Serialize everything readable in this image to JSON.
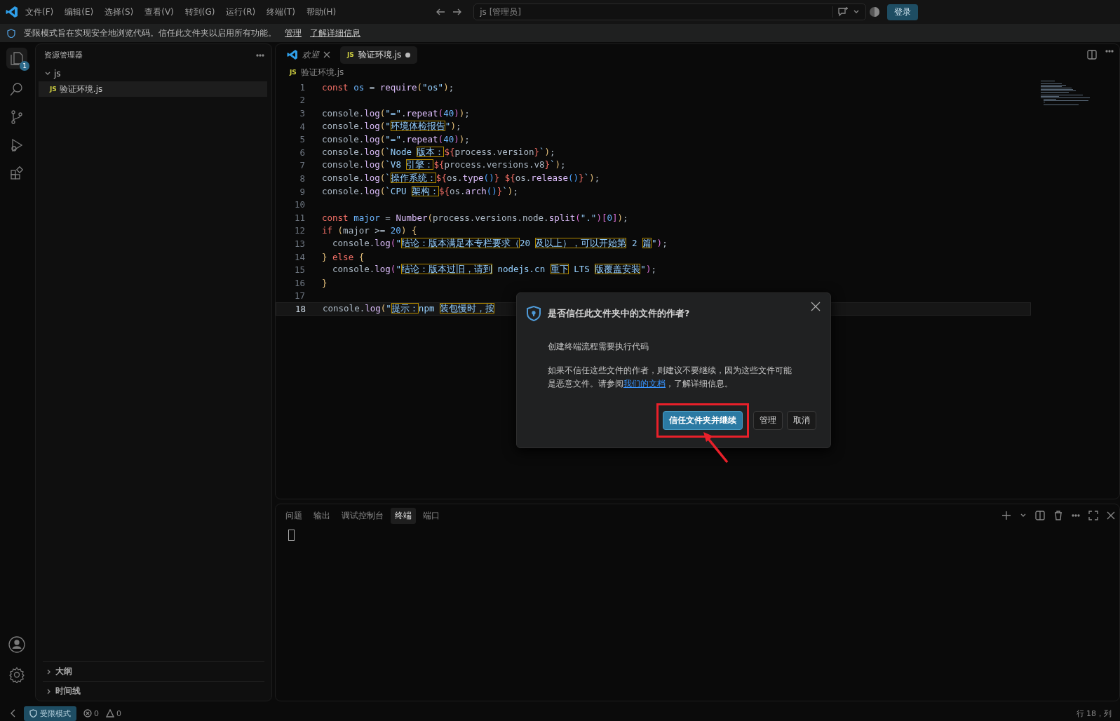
{
  "title_bar": {
    "menus": [
      "文件(F)",
      "编辑(E)",
      "选择(S)",
      "查看(V)",
      "转到(G)",
      "运行(R)",
      "终端(T)",
      "帮助(H)"
    ],
    "search": {
      "value": "js [管理员]"
    },
    "sign_in": "登录"
  },
  "banner": {
    "message": "受限模式旨在实现安全地浏览代码。信任此文件夹以启用所有功能。",
    "links": [
      "管理",
      "了解详细信息"
    ]
  },
  "activity_bar": {
    "badge": "1"
  },
  "sidebar": {
    "title": "资源管理器",
    "tree": [
      {
        "label": "js",
        "expanded": true,
        "children": [
          {
            "label": "验证环境.js",
            "badge": "JS",
            "selected": true
          }
        ]
      }
    ],
    "sections": [
      {
        "label": "大纲",
        "expanded": false
      },
      {
        "label": "时间线",
        "expanded": false
      }
    ]
  },
  "editor": {
    "tabs": [
      {
        "label": "欢迎",
        "kind": "welcome",
        "selected": false,
        "modified": false
      },
      {
        "label": "验证环境.js",
        "kind": "js",
        "badge": "JS",
        "selected": true,
        "modified": true
      }
    ],
    "breadcrumb": {
      "badge": "JS",
      "label": "验证环境.js"
    },
    "lines": [
      {
        "n": "1",
        "selected": false,
        "tokens": [
          {
            "kind": "keyword",
            "text": "const "
          },
          {
            "kind": "variable",
            "text": "os"
          },
          {
            "kind": "plain",
            "text": " = "
          },
          {
            "kind": "function",
            "text": "require"
          },
          {
            "kind": "bracket1",
            "text": "("
          },
          {
            "kind": "string",
            "text": "\"os\""
          },
          {
            "kind": "bracket1",
            "text": ")"
          },
          {
            "kind": "plain",
            "text": ";"
          }
        ]
      },
      {
        "n": "2",
        "selected": false
      },
      {
        "n": "3",
        "selected": false,
        "tokens": [
          {
            "kind": "plain",
            "text": "console."
          },
          {
            "kind": "function",
            "text": "log"
          },
          {
            "kind": "bracket1",
            "text": "("
          },
          {
            "kind": "string",
            "text": "\"=\""
          },
          {
            "kind": "plain",
            "text": "."
          },
          {
            "kind": "function",
            "text": "repeat"
          },
          {
            "kind": "bracket2",
            "text": "("
          },
          {
            "kind": "number",
            "text": "40"
          },
          {
            "kind": "bracket2",
            "text": ")"
          },
          {
            "kind": "bracket1",
            "text": ")"
          },
          {
            "kind": "plain",
            "text": ";"
          }
        ]
      },
      {
        "n": "4",
        "selected": false,
        "tokens": [
          {
            "kind": "plain",
            "text": "console."
          },
          {
            "kind": "function",
            "text": "log"
          },
          {
            "kind": "bracket1",
            "text": "("
          },
          {
            "kind": "string",
            "text": "\""
          },
          {
            "kind": "unicode",
            "text": "环境体检报告"
          },
          {
            "kind": "string",
            "text": "\""
          },
          {
            "kind": "bracket1",
            "text": ")"
          },
          {
            "kind": "plain",
            "text": ";"
          }
        ]
      },
      {
        "n": "5",
        "selected": false,
        "tokens": [
          {
            "kind": "plain",
            "text": "console."
          },
          {
            "kind": "function",
            "text": "log"
          },
          {
            "kind": "bracket1",
            "text": "("
          },
          {
            "kind": "string",
            "text": "\"=\""
          },
          {
            "kind": "plain",
            "text": "."
          },
          {
            "kind": "function",
            "text": "repeat"
          },
          {
            "kind": "bracket2",
            "text": "("
          },
          {
            "kind": "number",
            "text": "40"
          },
          {
            "kind": "bracket2",
            "text": ")"
          },
          {
            "kind": "bracket1",
            "text": ")"
          },
          {
            "kind": "plain",
            "text": ";"
          }
        ]
      },
      {
        "n": "6",
        "selected": false,
        "tokens": [
          {
            "kind": "plain",
            "text": "console."
          },
          {
            "kind": "function",
            "text": "log"
          },
          {
            "kind": "bracket1",
            "text": "("
          },
          {
            "kind": "string",
            "text": "`Node "
          },
          {
            "kind": "unicode",
            "text": "版本："
          },
          {
            "kind": "interp",
            "text": "${"
          },
          {
            "kind": "plain",
            "text": "process.version"
          },
          {
            "kind": "interp",
            "text": "}"
          },
          {
            "kind": "string",
            "text": "`"
          },
          {
            "kind": "bracket1",
            "text": ")"
          },
          {
            "kind": "plain",
            "text": ";"
          }
        ]
      },
      {
        "n": "7",
        "selected": false,
        "tokens": [
          {
            "kind": "plain",
            "text": "console."
          },
          {
            "kind": "function",
            "text": "log"
          },
          {
            "kind": "bracket1",
            "text": "("
          },
          {
            "kind": "string",
            "text": "`V8 "
          },
          {
            "kind": "unicode",
            "text": "引擎："
          },
          {
            "kind": "interp",
            "text": "${"
          },
          {
            "kind": "plain",
            "text": "process.versions.v8"
          },
          {
            "kind": "interp",
            "text": "}"
          },
          {
            "kind": "string",
            "text": "`"
          },
          {
            "kind": "bracket1",
            "text": ")"
          },
          {
            "kind": "plain",
            "text": ";"
          }
        ]
      },
      {
        "n": "8",
        "selected": false,
        "tokens": [
          {
            "kind": "plain",
            "text": "console."
          },
          {
            "kind": "function",
            "text": "log"
          },
          {
            "kind": "bracket1",
            "text": "("
          },
          {
            "kind": "string",
            "text": "`"
          },
          {
            "kind": "unicode",
            "text": "操作系统："
          },
          {
            "kind": "interp",
            "text": "${"
          },
          {
            "kind": "plain",
            "text": "os."
          },
          {
            "kind": "function",
            "text": "type"
          },
          {
            "kind": "bracket3",
            "text": "()"
          },
          {
            "kind": "interp",
            "text": "} ${"
          },
          {
            "kind": "plain",
            "text": "os."
          },
          {
            "kind": "function",
            "text": "release"
          },
          {
            "kind": "bracket3",
            "text": "()"
          },
          {
            "kind": "interp",
            "text": "}"
          },
          {
            "kind": "string",
            "text": "`"
          },
          {
            "kind": "bracket1",
            "text": ")"
          },
          {
            "kind": "plain",
            "text": ";"
          }
        ]
      },
      {
        "n": "9",
        "selected": false,
        "tokens": [
          {
            "kind": "plain",
            "text": "console."
          },
          {
            "kind": "function",
            "text": "log"
          },
          {
            "kind": "bracket1",
            "text": "("
          },
          {
            "kind": "string",
            "text": "`CPU "
          },
          {
            "kind": "unicode",
            "text": "架构："
          },
          {
            "kind": "interp",
            "text": "${"
          },
          {
            "kind": "plain",
            "text": "os."
          },
          {
            "kind": "function",
            "text": "arch"
          },
          {
            "kind": "bracket3",
            "text": "()"
          },
          {
            "kind": "interp",
            "text": "}"
          },
          {
            "kind": "string",
            "text": "`"
          },
          {
            "kind": "bracket1",
            "text": ")"
          },
          {
            "kind": "plain",
            "text": ";"
          }
        ]
      },
      {
        "n": "10",
        "selected": false
      },
      {
        "n": "11",
        "selected": false,
        "tokens": [
          {
            "kind": "keyword",
            "text": "const "
          },
          {
            "kind": "variable",
            "text": "major"
          },
          {
            "kind": "plain",
            "text": " = "
          },
          {
            "kind": "function",
            "text": "Number"
          },
          {
            "kind": "bracket1",
            "text": "("
          },
          {
            "kind": "plain",
            "text": "process.versions.node."
          },
          {
            "kind": "function",
            "text": "split"
          },
          {
            "kind": "bracket2",
            "text": "("
          },
          {
            "kind": "string",
            "text": "\".\""
          },
          {
            "kind": "bracket2",
            "text": ")"
          },
          {
            "kind": "bracket2",
            "text": "["
          },
          {
            "kind": "number",
            "text": "0"
          },
          {
            "kind": "bracket2",
            "text": "]"
          },
          {
            "kind": "bracket1",
            "text": ")"
          },
          {
            "kind": "plain",
            "text": ";"
          }
        ]
      },
      {
        "n": "12",
        "selected": false,
        "tokens": [
          {
            "kind": "keyword",
            "text": "if "
          },
          {
            "kind": "bracket1",
            "text": "("
          },
          {
            "kind": "plain",
            "text": "major >= "
          },
          {
            "kind": "number",
            "text": "20"
          },
          {
            "kind": "bracket1",
            "text": ") {"
          }
        ]
      },
      {
        "n": "13",
        "selected": false,
        "tokens": [
          {
            "kind": "plain",
            "text": "  console."
          },
          {
            "kind": "function",
            "text": "log"
          },
          {
            "kind": "bracket2",
            "text": "("
          },
          {
            "kind": "string",
            "text": "\""
          },
          {
            "kind": "unicode",
            "text": "结论：版本满足本专栏要求（"
          },
          {
            "kind": "string",
            "text": "20 "
          },
          {
            "kind": "unicode",
            "text": "及以上），可以开始第"
          },
          {
            "kind": "string",
            "text": " 2 "
          },
          {
            "kind": "unicode",
            "text": "篇"
          },
          {
            "kind": "string",
            "text": "\""
          },
          {
            "kind": "bracket2",
            "text": ")"
          },
          {
            "kind": "plain",
            "text": ";"
          }
        ]
      },
      {
        "n": "14",
        "selected": false,
        "tokens": [
          {
            "kind": "bracket1",
            "text": "}"
          },
          {
            "kind": "keyword",
            "text": " else "
          },
          {
            "kind": "bracket1",
            "text": "{"
          }
        ]
      },
      {
        "n": "15",
        "selected": false,
        "tokens": [
          {
            "kind": "plain",
            "text": "  console."
          },
          {
            "kind": "function",
            "text": "log"
          },
          {
            "kind": "bracket2",
            "text": "("
          },
          {
            "kind": "string",
            "text": "\""
          },
          {
            "kind": "unicode",
            "text": "结论：版本过旧，请到"
          },
          {
            "kind": "string",
            "text": " nodejs.cn "
          },
          {
            "kind": "unicode",
            "text": "重下"
          },
          {
            "kind": "string",
            "text": " LTS "
          },
          {
            "kind": "unicode",
            "text": "版覆盖安装"
          },
          {
            "kind": "string",
            "text": "\""
          },
          {
            "kind": "bracket2",
            "text": ")"
          },
          {
            "kind": "plain",
            "text": ";"
          }
        ]
      },
      {
        "n": "16",
        "selected": false,
        "tokens": [
          {
            "kind": "bracket1",
            "text": "}"
          }
        ]
      },
      {
        "n": "17",
        "selected": false
      },
      {
        "n": "18",
        "selected": true,
        "tokens": [
          {
            "kind": "plain",
            "text": "console."
          },
          {
            "kind": "function",
            "text": "log"
          },
          {
            "kind": "bracket1",
            "text": "("
          },
          {
            "kind": "string",
            "text": "\""
          },
          {
            "kind": "unicode",
            "text": "提示："
          },
          {
            "kind": "string",
            "text": "npm "
          },
          {
            "kind": "unicode",
            "text": "装包慢时，按"
          }
        ]
      }
    ]
  },
  "panel": {
    "tabs": [
      {
        "label": "问题",
        "selected": false
      },
      {
        "label": "输出",
        "selected": false
      },
      {
        "label": "调试控制台",
        "selected": false
      },
      {
        "label": "终端",
        "selected": true
      },
      {
        "label": "端口",
        "selected": false
      }
    ]
  },
  "dialog": {
    "title": "是否信任此文件夹中的文件的作者?",
    "subtitle": "创建终端流程需要执行代码",
    "body_before": "如果不信任这些文件的作者，则建议不要继续，因为这些文件可能是恶意文件。请参阅",
    "link": "我们的文档",
    "body_after": "，了解详细信息。",
    "buttons": [
      {
        "label": "信任文件夹并继续",
        "kind": "primary",
        "highlighted": true
      },
      {
        "label": "管理",
        "kind": "secondary",
        "highlighted": false
      },
      {
        "label": "取消",
        "kind": "secondary",
        "highlighted": false
      }
    ]
  },
  "status_bar": {
    "mode": "受限模式",
    "errors": "0",
    "warnings": "0",
    "position": "行 18，列"
  }
}
